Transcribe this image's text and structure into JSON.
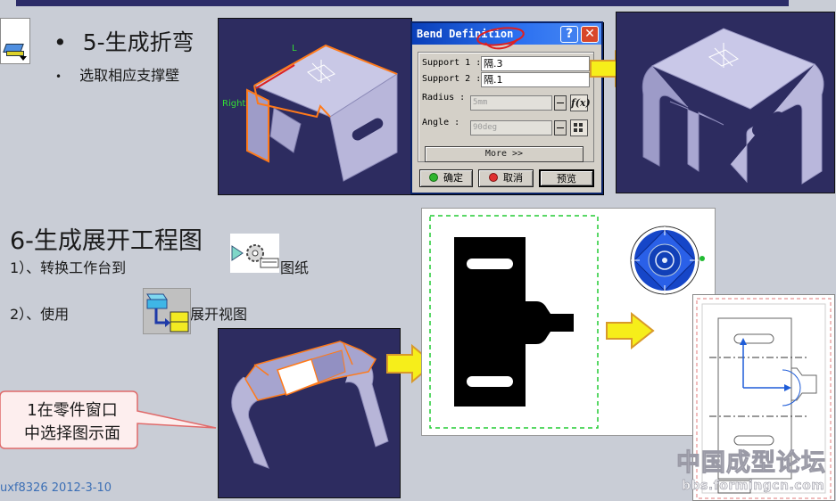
{
  "slide": {
    "step5_title": "5-生成折弯",
    "step5_bullet": "选取相应支撑壁",
    "step6_title": "6-生成展开工程图",
    "step6_line1_a": "1）、转换工作台到",
    "step6_line1_b": "图纸",
    "step6_line2_a": "2）、使用",
    "step6_line2_b": "展开视图",
    "callout_line1": "1在零件窗口",
    "callout_line2": "中选择图示面",
    "author": "uxf8326  2012-3-10"
  },
  "viewport1": {
    "label_right": "Right",
    "label_left": "L"
  },
  "dialog": {
    "title": "Bend Definition",
    "help_label": "?",
    "close_label": "✕",
    "support1_label": "Support 1 :",
    "support1_value": "隔.3",
    "support2_label": "Support 2 :",
    "support2_value": "隔.1",
    "radius_label": "Radius :",
    "radius_value": "5mm",
    "angle_label": "Angle :",
    "angle_value": "90deg",
    "fx_label": "f(x)",
    "more_label": "More >>",
    "ok_label": "确定",
    "cancel_label": "取消",
    "preview_label": "预览"
  },
  "watermark": {
    "title": "中国成型论坛",
    "url": "bbs.formingcn.com"
  },
  "colors": {
    "slide_bg": "#c9cdd6",
    "viewport_bg": "#2d2c60",
    "arrow_fill": "#f6ee1a",
    "arrow_stroke": "#d89a2a",
    "highlight_orange": "#ff7a1a",
    "titlebar_blue": "#0a3fb8",
    "dashed_green": "#22cc33",
    "accent_blue": "#3c6fb5"
  },
  "icons": [
    "sheetmetal-icon",
    "help-icon",
    "close-icon",
    "fx-icon",
    "calculator-icon",
    "arrow-right-icon",
    "workbench-switch-icon",
    "unfolded-view-icon",
    "compass-icon"
  ]
}
